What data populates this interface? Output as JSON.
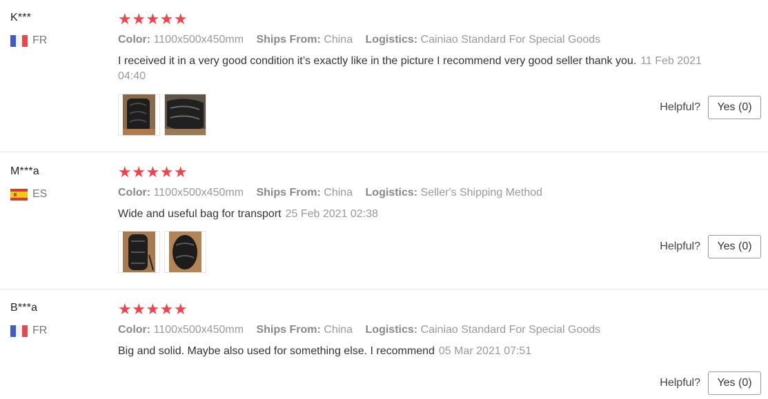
{
  "reviews": [
    {
      "user": "K***",
      "country": "FR",
      "stars": "★★★★★",
      "color_label": "Color:",
      "color_value": "1100x500x450mm",
      "ships_label": "Ships From:",
      "ships_value": "China",
      "logistics_label": "Logistics:",
      "logistics_value": "Cainiao Standard For Special Goods",
      "text": "I received it in a very good condition it’s exactly like in the picture I recommend very good seller thank you.",
      "date": "11 Feb 2021 04:40",
      "helpful_label": "Helpful?",
      "yes_label": "Yes (0)"
    },
    {
      "user": "M***a",
      "country": "ES",
      "stars": "★★★★★",
      "color_label": "Color:",
      "color_value": "1100x500x450mm",
      "ships_label": "Ships From:",
      "ships_value": "China",
      "logistics_label": "Logistics:",
      "logistics_value": "Seller's Shipping Method",
      "text": "Wide and useful bag for transport",
      "date": "25 Feb 2021 02:38",
      "helpful_label": "Helpful?",
      "yes_label": "Yes (0)"
    },
    {
      "user": "B***a",
      "country": "FR",
      "stars": "★★★★★",
      "color_label": "Color:",
      "color_value": "1100x500x450mm",
      "ships_label": "Ships From:",
      "ships_value": "China",
      "logistics_label": "Logistics:",
      "logistics_value": "Cainiao Standard For Special Goods",
      "text": "Big and solid. Maybe also used for something else. I recommend",
      "date": "05 Mar 2021 07:51",
      "helpful_label": "Helpful?",
      "yes_label": "Yes (0)"
    }
  ],
  "colors": {
    "star": "#f3424a",
    "meta_text": "#999999",
    "divider": "#e8e8e8"
  },
  "icons": {
    "rating": "star-icon",
    "flag_fr": "france-flag-icon",
    "flag_es": "spain-flag-icon"
  }
}
